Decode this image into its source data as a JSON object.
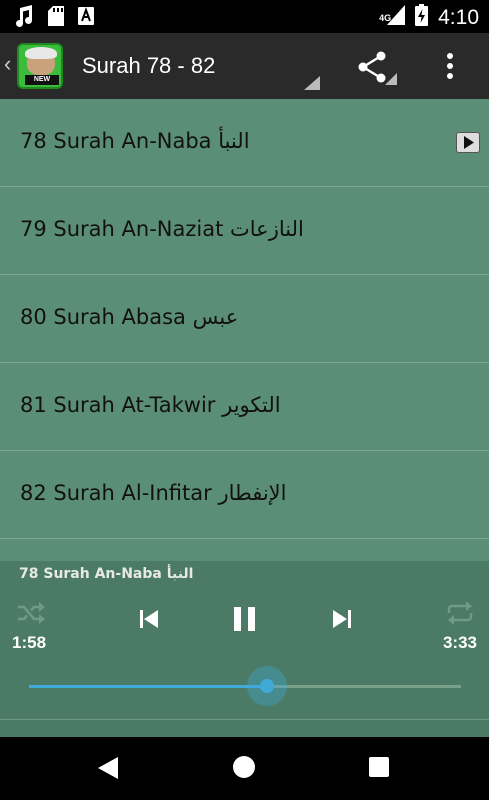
{
  "status_bar": {
    "time": "4:10",
    "network": "4G",
    "icons": [
      "music-note-icon",
      "sd-card-icon",
      "font-a-icon",
      "signal-icon",
      "battery-charging-icon"
    ]
  },
  "toolbar": {
    "title": "Surah 78 - 82",
    "app_icon_badge": "NEW",
    "icons": [
      "back-chevron-icon",
      "share-icon",
      "overflow-menu-icon"
    ]
  },
  "surah_list": [
    {
      "label": "78 Surah An-Naba النبأ",
      "playing": true
    },
    {
      "label": "79 Surah An-Naziat النازعات",
      "playing": false
    },
    {
      "label": "80 Surah Abasa عبس",
      "playing": false
    },
    {
      "label": "81 Surah At-Takwir التكوير",
      "playing": false
    },
    {
      "label": "82 Surah Al-Infitar الإنفطار",
      "playing": false
    }
  ],
  "player": {
    "now_playing": "78 Surah An-Naba النبأ",
    "current_time": "1:58",
    "duration": "3:33",
    "progress": 0.55,
    "icons": [
      "shuffle-icon",
      "skip-previous-icon",
      "pause-icon",
      "skip-next-icon",
      "repeat-icon"
    ]
  },
  "colors": {
    "list_bg": "#5b8e76",
    "player_bg": "#4b7b66",
    "toolbar_bg": "#2a2a2a",
    "accent": "#3fa9d8"
  }
}
